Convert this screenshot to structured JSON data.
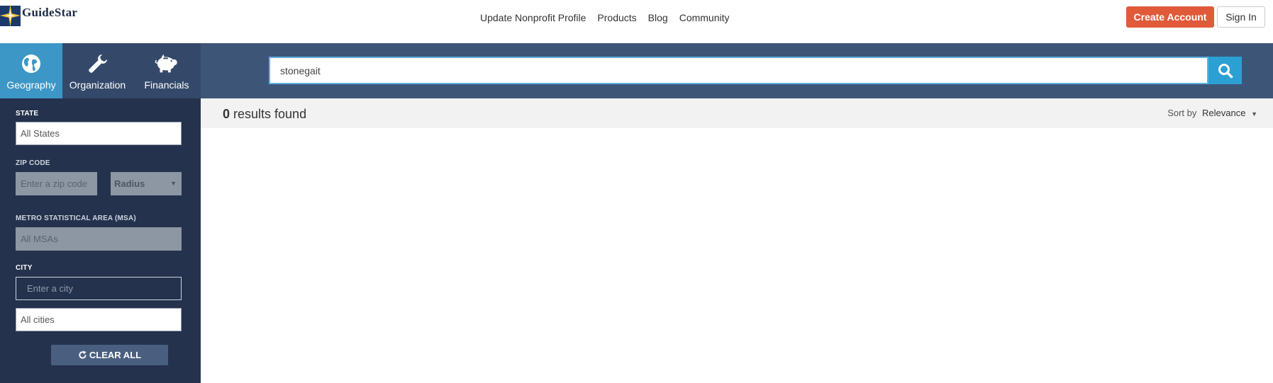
{
  "header": {
    "logo_text": "GuideStar",
    "nav": [
      "Update Nonprofit Profile",
      "Products",
      "Blog",
      "Community"
    ],
    "create_account": "Create Account",
    "sign_in": "Sign In",
    "colors": {
      "create_account_bg": "#e05a3a"
    }
  },
  "search": {
    "tabs": [
      {
        "label": "Geography",
        "icon": "globe-icon",
        "active": true
      },
      {
        "label": "Organization",
        "icon": "wrench-icon",
        "active": false
      },
      {
        "label": "Financials",
        "icon": "piggy-bank-icon",
        "active": false
      }
    ],
    "query": "stonegait",
    "button_icon": "search-icon"
  },
  "filters": {
    "state": {
      "label": "STATE",
      "placeholder": "All States"
    },
    "zip": {
      "label": "ZIP CODE",
      "placeholder": "Enter a zip code",
      "radius": "Radius"
    },
    "msa": {
      "label": "METRO STATISTICAL AREA (MSA)",
      "placeholder": "All MSAs"
    },
    "city": {
      "label": "CITY",
      "placeholder": "Enter a city",
      "select_placeholder": "All cities"
    },
    "clear_all": "CLEAR ALL"
  },
  "results": {
    "count": "0",
    "count_suffix": " results found",
    "sort_label": "Sort by",
    "sort_value": "Relevance"
  }
}
